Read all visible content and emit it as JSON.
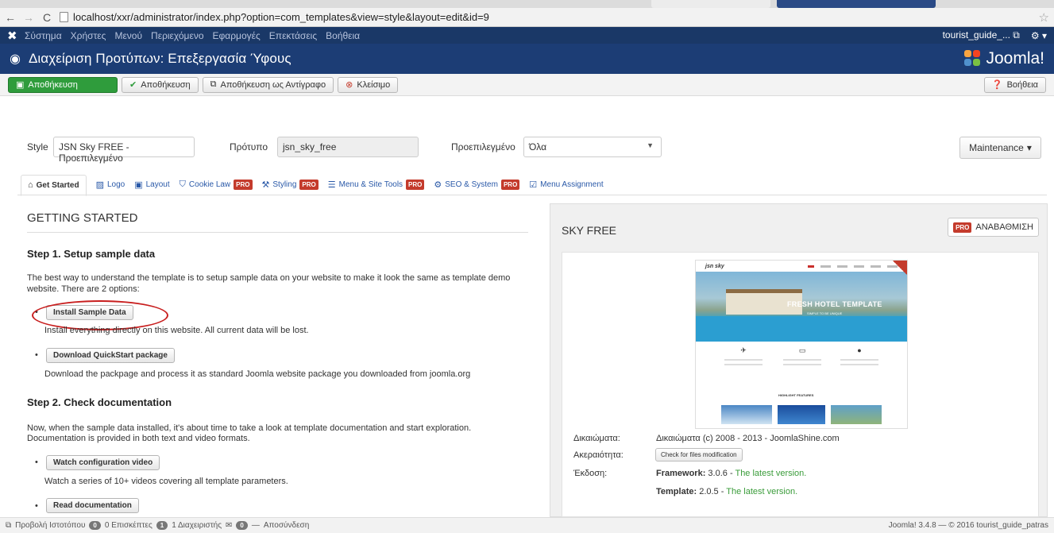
{
  "browser": {
    "url": "localhost/xxr/administrator/index.php?option=com_templates&view=style&layout=edit&id=9"
  },
  "topnav": {
    "items": [
      "Σύστημα",
      "Χρήστες",
      "Μενού",
      "Περιεχόμενο",
      "Εφαρμογές",
      "Επεκτάσεις",
      "Βοήθεια"
    ],
    "user": "tourist_guide_..."
  },
  "header": {
    "title": "Διαχείριση Προτύπων: Επεξεργασία Ύφους",
    "brand": "Joomla!"
  },
  "toolbar": {
    "save": "Αποθήκευση",
    "save_close": "Αποθήκευση",
    "save_copy": "Αποθήκευση ως Αντίγραφο",
    "close": "Κλείσιμο",
    "help": "Βοήθεια"
  },
  "form": {
    "style_label": "Style",
    "style_value": "JSN Sky FREE - Προεπιλεγμένο",
    "template_label": "Πρότυπο",
    "template_value": "jsn_sky_free",
    "default_label": "Προεπιλεγμένο",
    "default_value": "Όλα",
    "maintenance": "Maintenance"
  },
  "tabs": [
    {
      "label": "Get Started",
      "pro": false,
      "active": true
    },
    {
      "label": "Logo",
      "pro": false
    },
    {
      "label": "Layout",
      "pro": false
    },
    {
      "label": "Cookie Law",
      "pro": true
    },
    {
      "label": "Styling",
      "pro": true
    },
    {
      "label": "Menu & Site Tools",
      "pro": true
    },
    {
      "label": "SEO & System",
      "pro": true
    },
    {
      "label": "Menu Assignment",
      "pro": false
    }
  ],
  "pro_badge": "PRO",
  "getting_started": {
    "heading": "GETTING STARTED",
    "step1_title": "Step 1. Setup sample data",
    "step1_text_line1": "The best way to understand the template is to setup sample data on your website to make it look the same as template demo",
    "step1_text_line2": "website. There are 2 options:",
    "install_btn": "Install Sample Data",
    "install_desc": "Install everything directly on this website. All current data will be lost.",
    "download_btn": "Download QuickStart package",
    "download_desc": "Download the packpage and process it as standard Joomla website package you downloaded from joomla.org",
    "step2_title": "Step 2. Check documentation",
    "step2_text_line1": "Now, when the sample data installed, it's about time to take a look at template documentation and start exploration.",
    "step2_text_line2": "Documentation is provided in both text and video formats.",
    "video_btn": "Watch configuration video",
    "video_desc": "Watch a series of 10+ videos covering all template parameters.",
    "docs_btn": "Read documentation"
  },
  "sky_panel": {
    "title": "SKY FREE",
    "upgrade": "ΑΝΑΒΑΘΜΙΣΗ",
    "preview": {
      "logo": "jsn sky",
      "hero_title": "FRESH HOTEL TEMPLATE",
      "hero_sub": "SIMPLE TO BE UNIQUE",
      "highlight": "HIGHLIGHT FEATURES"
    },
    "copyright_label": "Δικαιώματα:",
    "copyright_value": "Δικαιώματα (c) 2008 - 2013 - JoomlaShine.com",
    "integrity_label": "Ακεραιότητα:",
    "integrity_btn": "Check for files modification",
    "version_label": "Έκδοση:",
    "framework_label": "Framework:",
    "framework_version": "3.0.6",
    "framework_status": "The latest version.",
    "template_label": "Template:",
    "template_version": "2.0.5",
    "template_status": "The latest version."
  },
  "statusbar": {
    "view_site": "Προβολή Ιστοτόπου",
    "visitors_count": "0",
    "visitors": "0 Επισκέπτες",
    "admins_count": "1",
    "admins": "1 Διαχειριστής",
    "messages_count": "0",
    "logout": "Αποσύνδεση",
    "footer": "Joomla! 3.4.8 — © 2016 tourist_guide_patras"
  },
  "colors": {
    "header_bg": "#1c3d75",
    "topnav_bg": "#1a3867",
    "save_green": "#2f9c3c",
    "pro_red": "#c43b2c",
    "annotation_red": "#c81e1e",
    "ok_green": "#3a9c3a"
  }
}
